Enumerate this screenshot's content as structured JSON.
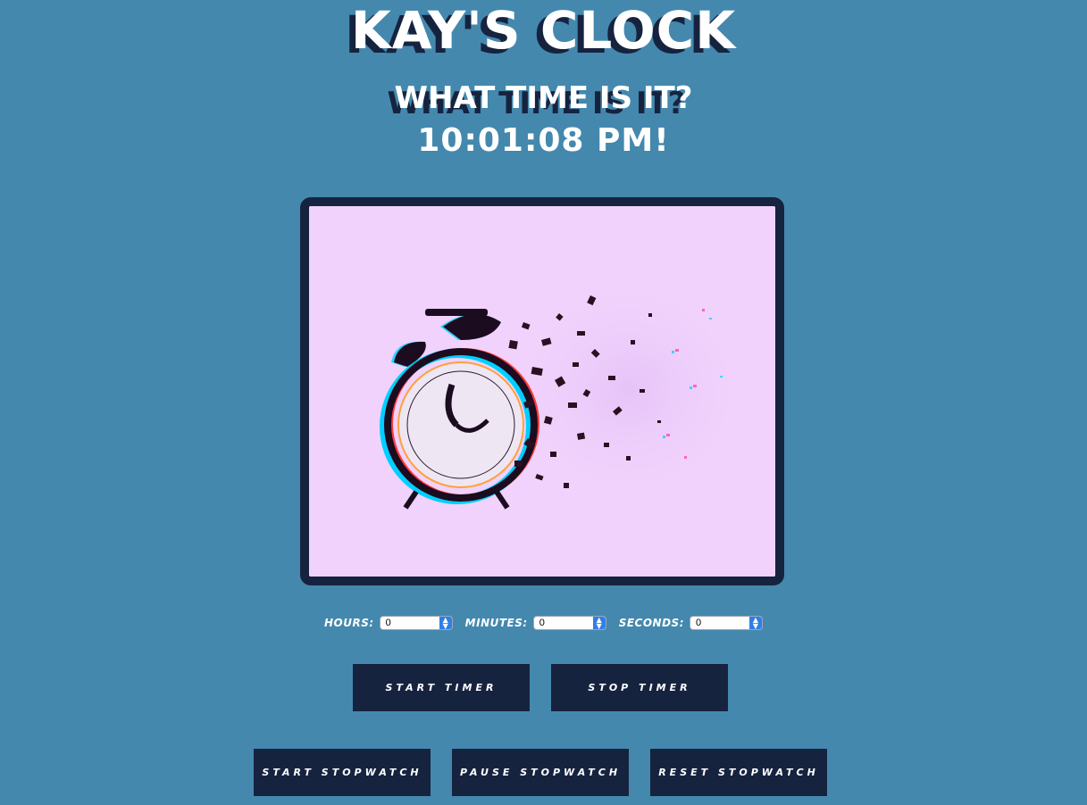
{
  "header": {
    "title": "KAY'S CLOCK",
    "subtitle": "WHAT TIME IS IT?",
    "time": "10:01:08 PM!"
  },
  "image": {
    "icon": "shattering-alarm-clock-icon",
    "background_color": "#f0d2fc"
  },
  "timer_controls": {
    "hours_label": "HOURS:",
    "hours_value": "0",
    "minutes_label": "MINUTES:",
    "minutes_value": "0",
    "seconds_label": "SECONDS:",
    "seconds_value": "0"
  },
  "buttons": {
    "start_timer": "START TIMER",
    "stop_timer": "STOP TIMER",
    "start_stopwatch": "START STOPWATCH",
    "pause_stopwatch": "PAUSE STOPWATCH",
    "reset_stopwatch": "RESET STOPWATCH"
  },
  "colors": {
    "page_background": "#4488ae",
    "dark_navy": "#16233f",
    "text": "#ffffff",
    "select_accent": "#2f7fe9"
  }
}
